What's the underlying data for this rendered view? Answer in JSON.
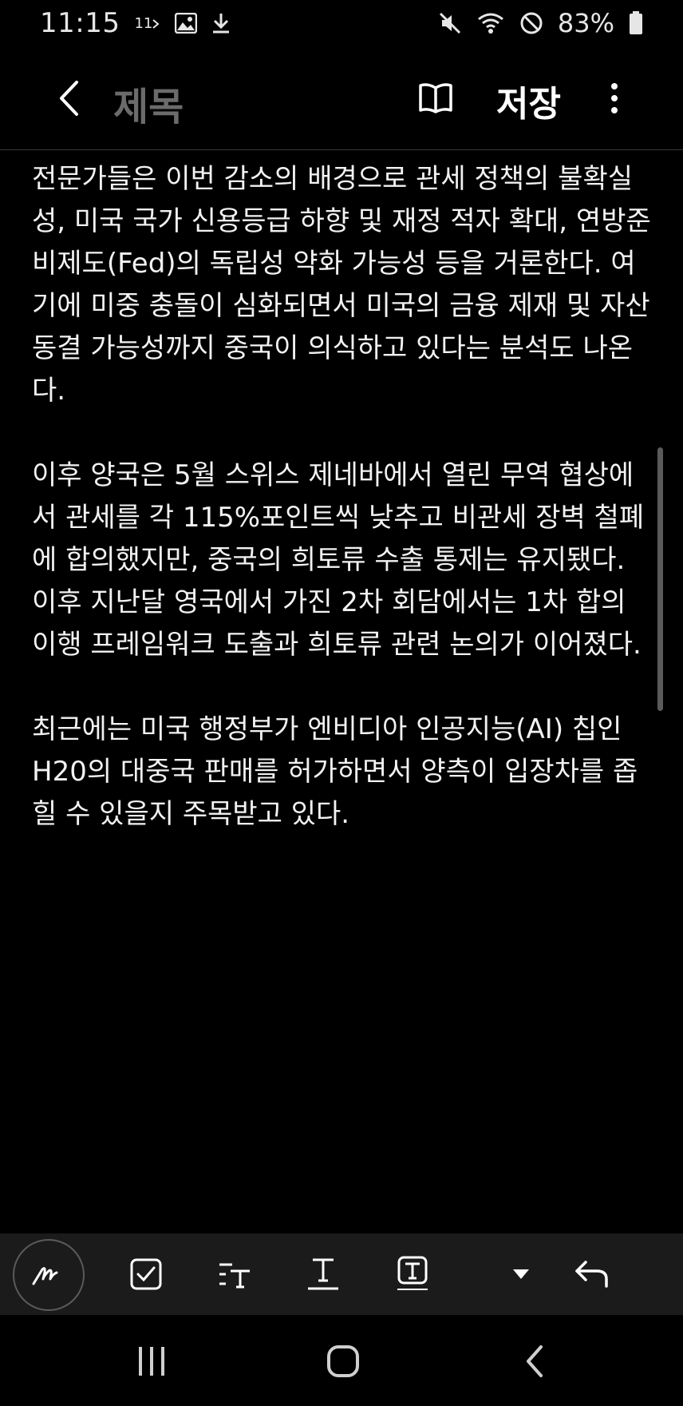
{
  "status_bar": {
    "time": "11:15",
    "notif_label": "11",
    "battery_percent": "83%"
  },
  "app_bar": {
    "title": "제목",
    "save_label": "저장"
  },
  "content": {
    "paragraphs": [
      "전문가들은 이번 감소의 배경으로 관세 정책의 불확실성, 미국 국가 신용등급 하향 및 재정 적자 확대, 연방준비제도(Fed)의 독립성 약화 가능성 등을 거론한다. 여기에 미중 충돌이 심화되면서 미국의 금융 제재 및 자산 동결 가능성까지 중국이 의식하고 있다는 분석도 나온다.",
      "이후 양국은 5월 스위스 제네바에서 열린 무역 협상에서 관세를 각 115%포인트씩 낮추고 비관세 장벽 철폐에 합의했지만, 중국의 희토류 수출 통제는 유지됐다. 이후 지난달 영국에서 가진 2차 회담에서는 1차 합의 이행 프레임워크 도출과 희토류 관련 논의가 이어졌다.",
      "최근에는 미국 행정부가 엔비디아 인공지능(AI) 칩인 H20의 대중국 판매를 허가하면서 양측이 입장차를 좁힐 수 있을지 주목받고 있다."
    ]
  },
  "icons": {
    "status": [
      "notification-11-icon",
      "image-icon",
      "download-icon",
      "mute-icon",
      "wifi-icon",
      "do-not-disturb-icon",
      "battery-icon"
    ],
    "app_bar": [
      "back-arrow-icon",
      "book-icon",
      "more-vert-icon"
    ],
    "toolbar": [
      "pen-icon",
      "checkbox-icon",
      "text-style-icon",
      "text-underline-icon",
      "text-box-icon",
      "dropdown-icon",
      "undo-icon"
    ],
    "nav": [
      "recents-icon",
      "home-icon",
      "back-icon"
    ]
  }
}
